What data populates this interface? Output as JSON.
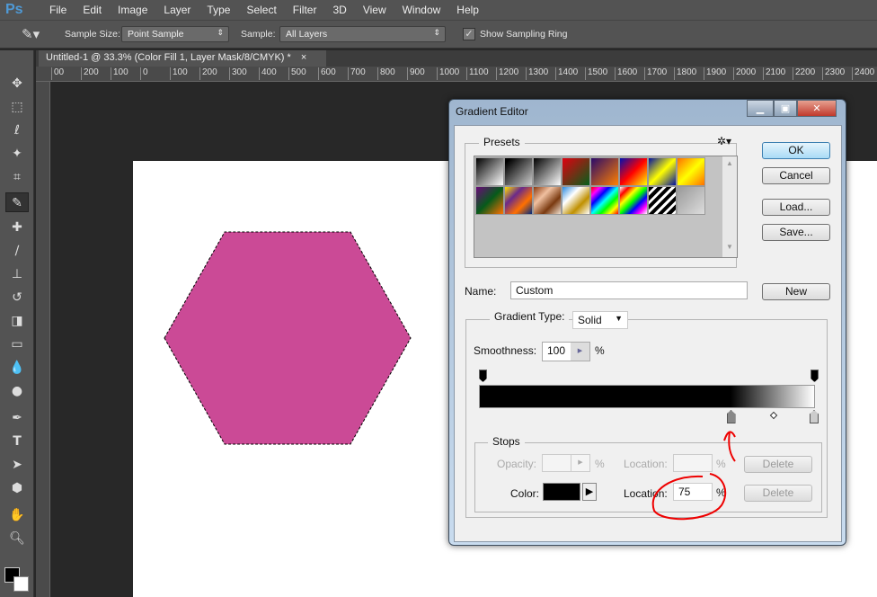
{
  "app": {
    "logo": "Ps",
    "menu": [
      "File",
      "Edit",
      "Image",
      "Layer",
      "Type",
      "Select",
      "Filter",
      "3D",
      "View",
      "Window",
      "Help"
    ]
  },
  "options": {
    "sample_size_label": "Sample Size:",
    "sample_size_value": "Point Sample",
    "sample_label": "Sample:",
    "sample_value": "All Layers",
    "show_ring_label": "Show Sampling Ring",
    "show_ring_checked": true
  },
  "document": {
    "tab_title": "Untitled-1 @ 33.3% (Color Fill 1, Layer Mask/8/CMYK) *",
    "close": "×",
    "ruler_labels": [
      "00",
      "200",
      "100",
      "0",
      "100",
      "200",
      "300",
      "400",
      "500",
      "600",
      "700",
      "800",
      "900",
      "1000",
      "1100",
      "1200",
      "1300",
      "1400",
      "1500",
      "1600",
      "1700",
      "1800",
      "1900",
      "2000",
      "2100",
      "2200",
      "2300",
      "2400"
    ],
    "shape_color": "#cb4a96"
  },
  "dialog": {
    "title": "Gradient Editor",
    "presets_label": "Presets",
    "ok": "OK",
    "cancel": "Cancel",
    "load": "Load...",
    "save": "Save...",
    "name_label": "Name:",
    "name_value": "Custom",
    "new": "New",
    "gradient_type_label": "Gradient Type:",
    "gradient_type_value": "Solid",
    "smoothness_label": "Smoothness:",
    "smoothness_value": "100",
    "pct": "%",
    "stops_label": "Stops",
    "opacity_label": "Opacity:",
    "location_label": "Location:",
    "delete": "Delete",
    "color_label": "Color:",
    "color_location_value": "75",
    "color_stop_location": 75,
    "stop_color": "#000000"
  }
}
